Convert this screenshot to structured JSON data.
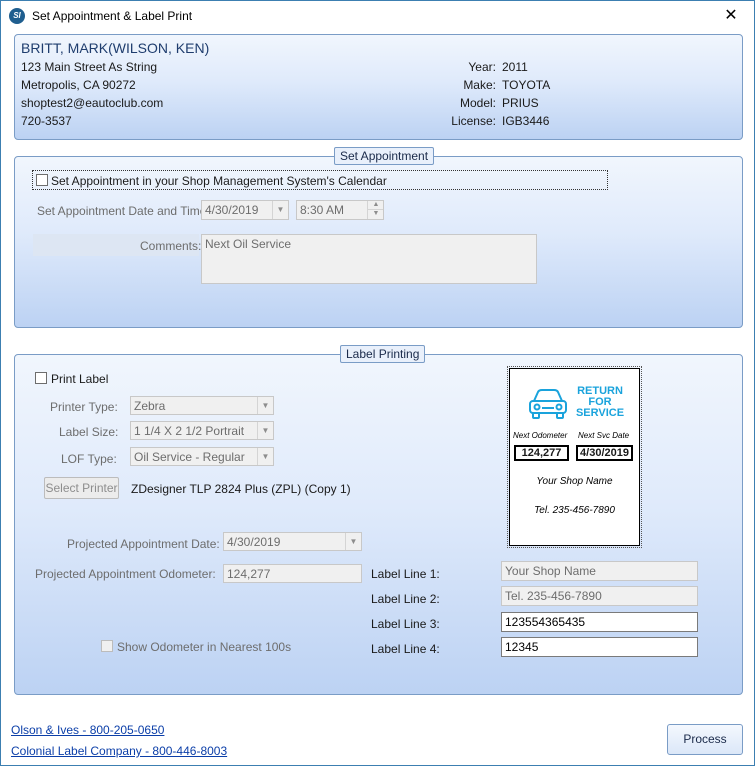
{
  "window": {
    "title": "Set Appointment & Label Print",
    "icon_text": "SI",
    "close_glyph": "✕"
  },
  "customer": {
    "name": "BRITT, MARK(WILSON, KEN)",
    "address": "123 Main Street As String",
    "city": "Metropolis, CA 90272",
    "email": "shoptest2@eautoclub.com",
    "phone": "720-3537"
  },
  "vehicle": {
    "year_label": "Year:",
    "year": "2011",
    "make_label": "Make:",
    "make": "TOYOTA",
    "model_label": "Model:",
    "model": "PRIUS",
    "license_label": "License:",
    "license": "IGB3446"
  },
  "appointment": {
    "legend": "Set Appointment",
    "checkbox_label": "Set Appointment in your Shop Management System's Calendar",
    "checked": false,
    "datetime_label": "Set Appointment Date and Time:",
    "date_value": "4/30/2019",
    "time_value": "8:30 AM",
    "comments_label": "Comments:",
    "comments_value": "Next Oil Service"
  },
  "label_printing": {
    "legend": "Label Printing",
    "print_label": "Print Label",
    "print_checked": false,
    "printer_type_label": "Printer Type:",
    "printer_type": "Zebra",
    "label_size_label": "Label Size:",
    "label_size": "1 1/4 X 2 1/2 Portrait",
    "lof_type_label": "LOF Type:",
    "lof_type": "Oil Service - Regular",
    "select_printer_button": "Select Printer",
    "printer_name": "ZDesigner TLP 2824 Plus (ZPL) (Copy 1)",
    "projected_date_label": "Projected Appointment Date:",
    "projected_date": "4/30/2019",
    "projected_odometer_label": "Projected Appointment Odometer:",
    "projected_odometer": "124,277",
    "show_odometer_label": "Show Odometer in Nearest 100s",
    "label_line_1_label": "Label Line 1:",
    "label_line_1": "Your Shop Name",
    "label_line_2_label": "Label Line 2:",
    "label_line_2": "Tel. 235-456-7890",
    "label_line_3_label": "Label Line 3:",
    "label_line_3": "123554365435",
    "label_line_4_label": "Label Line 4:",
    "label_line_4": "12345"
  },
  "preview": {
    "headline": "RETURN FOR SERVICE",
    "next_odometer_label": "Next Odometer",
    "next_svc_date_label": "Next Svc Date",
    "odometer": "124,277",
    "svc_date": "4/30/2019",
    "shop_name": "Your Shop Name",
    "phone": "Tel. 235-456-7890",
    "accent_color": "#1aa3dc"
  },
  "footer": {
    "link_1": "Olson & Ives - 800-205-0650",
    "link_2": "Colonial Label Company - 800-446-8003",
    "process_button": "Process"
  }
}
